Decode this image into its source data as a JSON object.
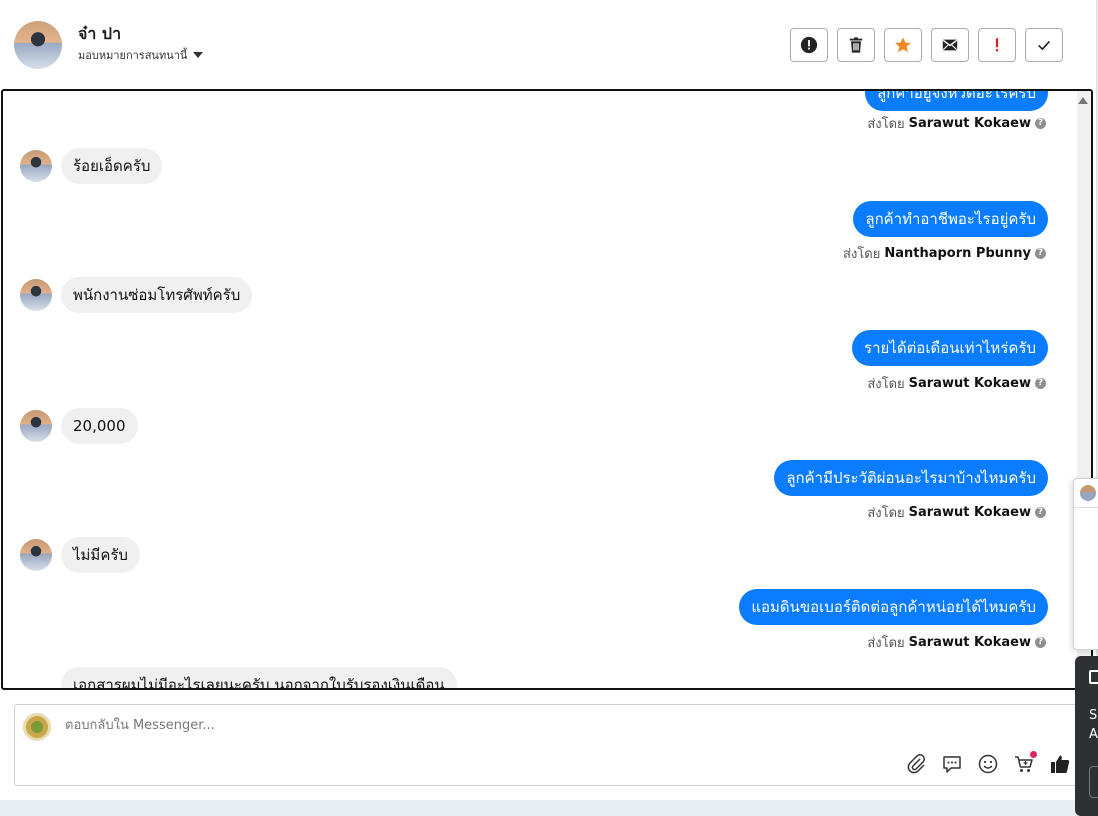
{
  "header": {
    "contact_name": "จ๋า ปา",
    "assign_label": "มอบหมายการสนทนานี้",
    "actions": [
      {
        "name": "spam-button",
        "icon": "alert-circle-icon"
      },
      {
        "name": "delete-button",
        "icon": "trash-icon"
      },
      {
        "name": "star-button",
        "icon": "star-icon"
      },
      {
        "name": "mark-unread-button",
        "icon": "envelope-icon"
      },
      {
        "name": "follow-up-button",
        "icon": "exclamation-icon"
      },
      {
        "name": "done-button",
        "icon": "check-icon"
      }
    ]
  },
  "messages": {
    "m0": {
      "text": "ลูกค้าอยู่จังหวัดอะไรครับ"
    },
    "s0": {
      "prefix": "ส่งโดย",
      "name": "Sarawut Kokaew"
    },
    "i1": {
      "text": "ร้อยเอ็ดครับ"
    },
    "m1": {
      "text": "ลูกค้าทำอาชีพอะไรอยู่ครับ"
    },
    "s1": {
      "prefix": "ส่งโดย",
      "name": "Nanthaporn Pbunny"
    },
    "i2": {
      "text": "พนักงานซ่อมโทรศัพท์ครับ"
    },
    "m2": {
      "text": "รายได้ต่อเดือนเท่าไหร่ครับ"
    },
    "s2": {
      "prefix": "ส่งโดย",
      "name": "Sarawut Kokaew"
    },
    "i3": {
      "text": "20,000"
    },
    "m3": {
      "text": "ลูกค้ามีประวัติผ่อนอะไรมาบ้างไหมครับ"
    },
    "s3": {
      "prefix": "ส่งโดย",
      "name": "Sarawut Kokaew"
    },
    "i4": {
      "text": "ไม่มีครับ"
    },
    "m4": {
      "text": "แอมดินขอเบอร์ติดต่อลูกค้าหน่อยได้ไหมครับ"
    },
    "s4": {
      "prefix": "ส่งโดย",
      "name": "Sarawut Kokaew"
    },
    "i5": {
      "text": "เอกสารผมไม่มีอะไรเลยนะครับ นอกจากใบรับรองเงินเดือน"
    }
  },
  "composer": {
    "placeholder": "ตอบกลับใน Messenger...",
    "tools": [
      "paperclip-icon",
      "chat-bubble-icon",
      "smiley-icon",
      "cart-icon",
      "thumbs-up-icon"
    ]
  },
  "side_popup": {
    "letter1": "S",
    "letter2": "A"
  },
  "colors": {
    "outgoing_bubble": "#0a7cff",
    "incoming_bubble": "#f0f0f0",
    "star": "#f08a24",
    "follow_up": "#e02020"
  }
}
